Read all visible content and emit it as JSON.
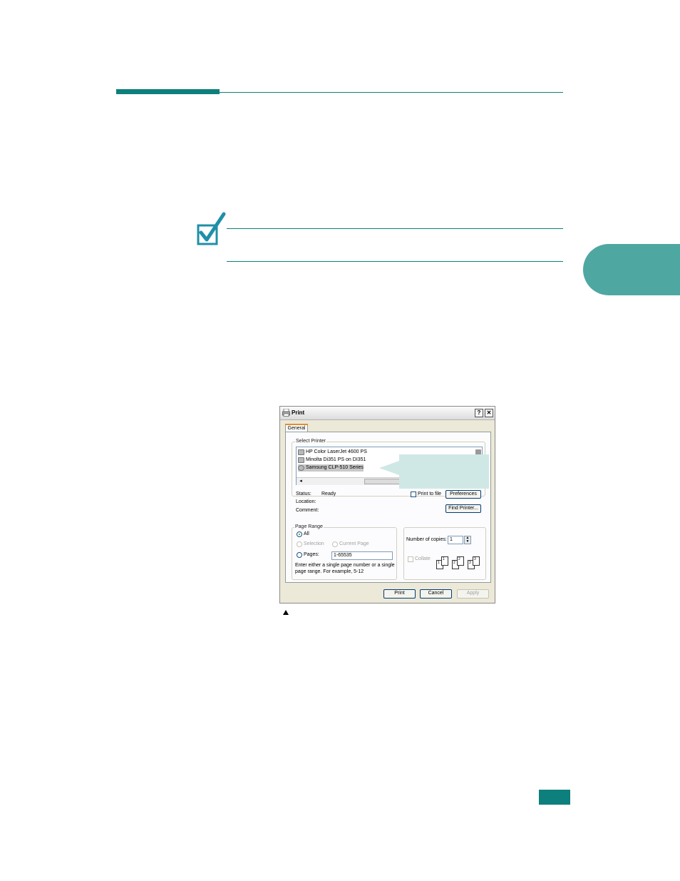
{
  "dialog": {
    "title": "Print",
    "help_glyph": "?",
    "close_glyph": "✕",
    "tab_general": "General",
    "select_printer_legend": "Select Printer",
    "printers": [
      {
        "name": "HP Color LaserJet 4600 PS",
        "selected": false
      },
      {
        "name": "Minolta Di351 PS on DI351",
        "selected": false
      },
      {
        "name": "Samsung CLP-510 Series",
        "selected": true
      }
    ],
    "scroll_left": "◂",
    "scroll_right": "▸",
    "status_label": "Status:",
    "status_value": "Ready",
    "location_label": "Location:",
    "comment_label": "Comment:",
    "print_to_file_label": "Print to file",
    "preferences_button": "Preferences",
    "find_printer_button": "Find Printer...",
    "page_range_legend": "Page Range",
    "range_all": "All",
    "range_selection": "Selection",
    "range_current_page": "Current Page",
    "range_pages": "Pages:",
    "pages_value": "1-65535",
    "range_hint_line1": "Enter either a single page number or a single",
    "range_hint_line2": "page range.  For example, 5-12",
    "number_of_copies_label": "Number of copies:",
    "copies_value": "1",
    "collate_label": "Collate",
    "collate_sheets": [
      "1",
      "1",
      "2",
      "2",
      "3",
      "3"
    ],
    "print_button": "Print",
    "cancel_button": "Cancel",
    "apply_button": "Apply"
  },
  "colors": {
    "accent": "#0d7f7c",
    "chapter_tab": "#4fa7a2",
    "callout": "#cfe8e6"
  }
}
